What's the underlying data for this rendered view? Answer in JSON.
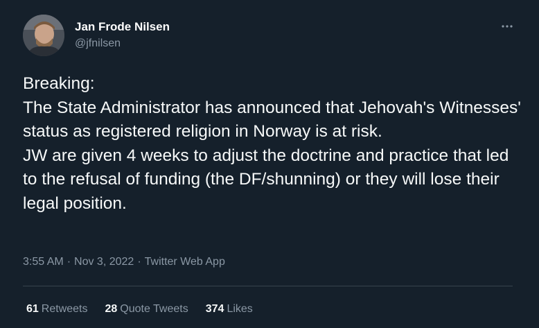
{
  "author": {
    "display_name": "Jan Frode Nilsen",
    "handle": "@jfnilsen"
  },
  "tweet": {
    "text": "Breaking:\nThe State Administrator has announced that Jehovah's Witnesses' status as registered religion in Norway is at risk.\nJW are given 4 weeks to adjust the doctrine and practice that led to the refusal of funding (the DF/shunning) or they will lose their legal position.",
    "time": "3:55 AM",
    "date": "Nov 3, 2022",
    "source": "Twitter Web App",
    "separator": "·"
  },
  "stats": {
    "retweets_count": "61",
    "retweets_label": "Retweets",
    "quotes_count": "28",
    "quotes_label": "Quote Tweets",
    "likes_count": "374",
    "likes_label": "Likes"
  },
  "icons": {
    "more": "more-horizontal-icon"
  },
  "colors": {
    "background": "#15202b",
    "text_primary": "#f7f9f9",
    "text_secondary": "#8b98a5",
    "divider": "#38444d"
  }
}
